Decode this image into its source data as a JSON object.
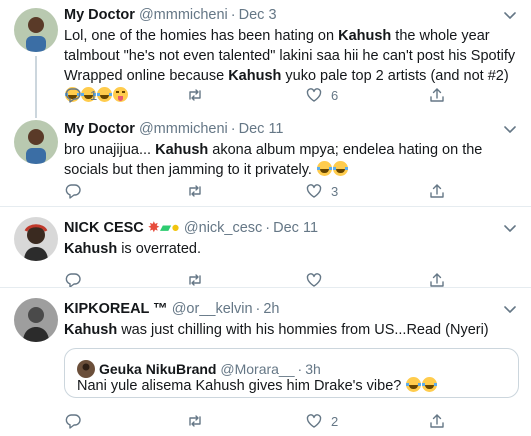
{
  "tweets": [
    {
      "name": "My Doctor",
      "handle": "@mmmicheni",
      "separator": "·",
      "time": "Dec 3",
      "text_parts": [
        "Lol, one of the homies has been hating on ",
        "Kahush",
        " the whole year talmbout \"he's not even talented\" lakini saa hii he can't post his Spotify Wrapped online because ",
        "Kahush",
        " yuko pale top 2 artists (and not #2)"
      ],
      "emojis": [
        "joy",
        "joy",
        "joy",
        "tongue"
      ],
      "reply_count": "1",
      "retweet_count": "",
      "like_count": "6"
    },
    {
      "name": "My Doctor",
      "handle": "@mmmicheni",
      "separator": "·",
      "time": "Dec 11",
      "text_parts": [
        "bro unajijua... ",
        "Kahush",
        " akona album mpya; endelea hating on the socials but then jamming to it privately."
      ],
      "emojis": [
        "joy",
        "joy"
      ],
      "reply_count": "",
      "retweet_count": "",
      "like_count": "3"
    },
    {
      "name": "NICK CESC",
      "name_emojis": [
        "collision",
        "gun",
        "sunglasses"
      ],
      "handle": "@nick_cesc",
      "separator": "·",
      "time": "Dec 11",
      "text_parts": [
        "Kahush",
        " is overrated."
      ],
      "reply_count": "",
      "retweet_count": "",
      "like_count": ""
    },
    {
      "name": "KIPKOREAL ™",
      "handle": "@or__kelvin",
      "separator": "·",
      "time": "2h",
      "text_parts": [
        "Kahush",
        " was just chilling with his hommies from US...Read (Nyeri)"
      ],
      "quote": {
        "name": "Geuka NikuBrand",
        "handle": "@Morara__",
        "separator": "·",
        "time": "3h",
        "text": "Nani yule alisema Kahush gives him Drake's vibe?",
        "emojis": [
          "joy",
          "joy"
        ]
      },
      "reply_count": "",
      "retweet_count": "",
      "like_count": "2"
    }
  ],
  "icons": {
    "reply": "reply-icon",
    "retweet": "retweet-icon",
    "like": "heart-icon",
    "share": "share-icon",
    "more": "chevron-down-icon"
  },
  "colors": {
    "text": "#14171a",
    "secondary": "#657786",
    "border": "#e6ecf0",
    "thread_line": "#ccd6dd"
  }
}
